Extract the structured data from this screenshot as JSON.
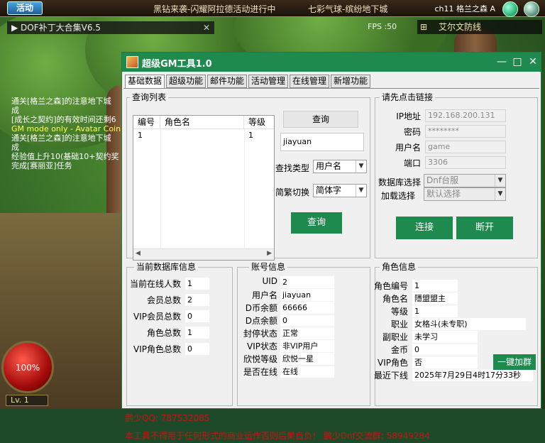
{
  "game": {
    "event_button": "活动",
    "ticker_1": "黑钻来袭-闪耀阿拉德活动进行中",
    "ticker_2": "七彩气球-缤纷地下城",
    "channel": "ch11 格兰之森 A",
    "dof_bar": "DOF补丁大合集V6.5",
    "fps": "FPS :50",
    "map_name": "艾尔文防线",
    "chat": [
      {
        "text": "通关[格兰之森]的注意地下城",
        "color": "#ffffff"
      },
      {
        "text": "成",
        "color": "#ffffff"
      },
      {
        "text": "[成长之契约]的有效时间还剩6",
        "color": "#ffffff"
      },
      {
        "text": "GM mode only - Avatar Coin O",
        "color": "#ffff55"
      },
      {
        "text": "通关[格兰之森]的注意地下城",
        "color": "#ffffff"
      },
      {
        "text": "成",
        "color": "#ffffff"
      },
      {
        "text": "经验值上升10(基础10+契约奖",
        "color": "#ffffff"
      },
      {
        "text": "完成[赛丽亚]任务",
        "color": "#ffffff"
      }
    ],
    "hp_percent_text": "100%",
    "level_text": "Lv. 1"
  },
  "window": {
    "title": "超级GM工具1.0",
    "controls": {
      "minimize": "—",
      "maximize": "□",
      "close": "✕"
    },
    "tabs": [
      {
        "label": "基础数据",
        "active": true
      },
      {
        "label": "超级功能",
        "active": false
      },
      {
        "label": "邮件功能",
        "active": false
      },
      {
        "label": "活动管理",
        "active": false
      },
      {
        "label": "在线管理",
        "active": false
      },
      {
        "label": "新增功能",
        "active": false
      }
    ]
  },
  "query": {
    "group_title": "查询列表",
    "columns": [
      "编号",
      "角色名",
      "等级"
    ],
    "rows": [
      {
        "id": "1",
        "name": "",
        "level": "1"
      }
    ],
    "query_button_top": "查询",
    "search_value": "jiayuan",
    "find_type_label": "查找类型",
    "find_type_value": "用户名",
    "charset_label": "简繁切换",
    "charset_value": "简体字",
    "query_button": "查询"
  },
  "connection": {
    "group_title": "请先点击链接",
    "ip_label": "IP地址",
    "ip_value": "192.168.200.131",
    "password_label": "密码",
    "password_value": "********",
    "username_label": "用户名",
    "username_value": "game",
    "port_label": "端口",
    "port_value": "3306",
    "db_select_label": "数据库选择",
    "db_select_value": "Dnf台服",
    "load_select_label": "加载选择",
    "load_select_value": "默认选择",
    "connect_button": "连接",
    "disconnect_button": "断开"
  },
  "db_info": {
    "group_title": "当前数据库信息",
    "rows": [
      {
        "label": "当前在线人数",
        "value": "1"
      },
      {
        "label": "会员总数",
        "value": "2"
      },
      {
        "label": "VIP会员总数",
        "value": "0"
      },
      {
        "label": "角色总数",
        "value": "1"
      },
      {
        "label": "VIP角色总数",
        "value": "0"
      }
    ]
  },
  "account": {
    "group_title": "账号信息",
    "rows": [
      {
        "label": "UID",
        "value": "2"
      },
      {
        "label": "用户名",
        "value": "jiayuan"
      },
      {
        "label": "D币余额",
        "value": "66666"
      },
      {
        "label": "D点余额",
        "value": "0"
      },
      {
        "label": "封停状态",
        "value": "正常"
      },
      {
        "label": "VIP状态",
        "value": "非VIP用户"
      },
      {
        "label": "欣悦等级",
        "value": "欣悦一星"
      },
      {
        "label": "是否在线",
        "value": "在线"
      }
    ]
  },
  "character": {
    "group_title": "角色信息",
    "rows": [
      {
        "label": "角色编号",
        "value": "1"
      },
      {
        "label": "角色名",
        "value": "隱盟盟主"
      },
      {
        "label": "等级",
        "value": "1"
      },
      {
        "label": "职业",
        "value": "女格斗(未专职)"
      },
      {
        "label": "副职业",
        "value": "未学习"
      },
      {
        "label": "金币",
        "value": "0"
      },
      {
        "label": "VIP角色",
        "value": "否"
      },
      {
        "label": "最近下线",
        "value": "2025年7月29日4时17分33秒"
      }
    ],
    "one_click_button": "一键加群"
  },
  "footer": {
    "qq": "鹏少QQ: 787532085",
    "disclaimer": "本工具不得用于任何形式的商业运作否则后果自负！ 鹏少Dnf交流群: 58949284"
  },
  "colors": {
    "accent": "#1e8a4e",
    "footer_text": "#cc1111"
  }
}
